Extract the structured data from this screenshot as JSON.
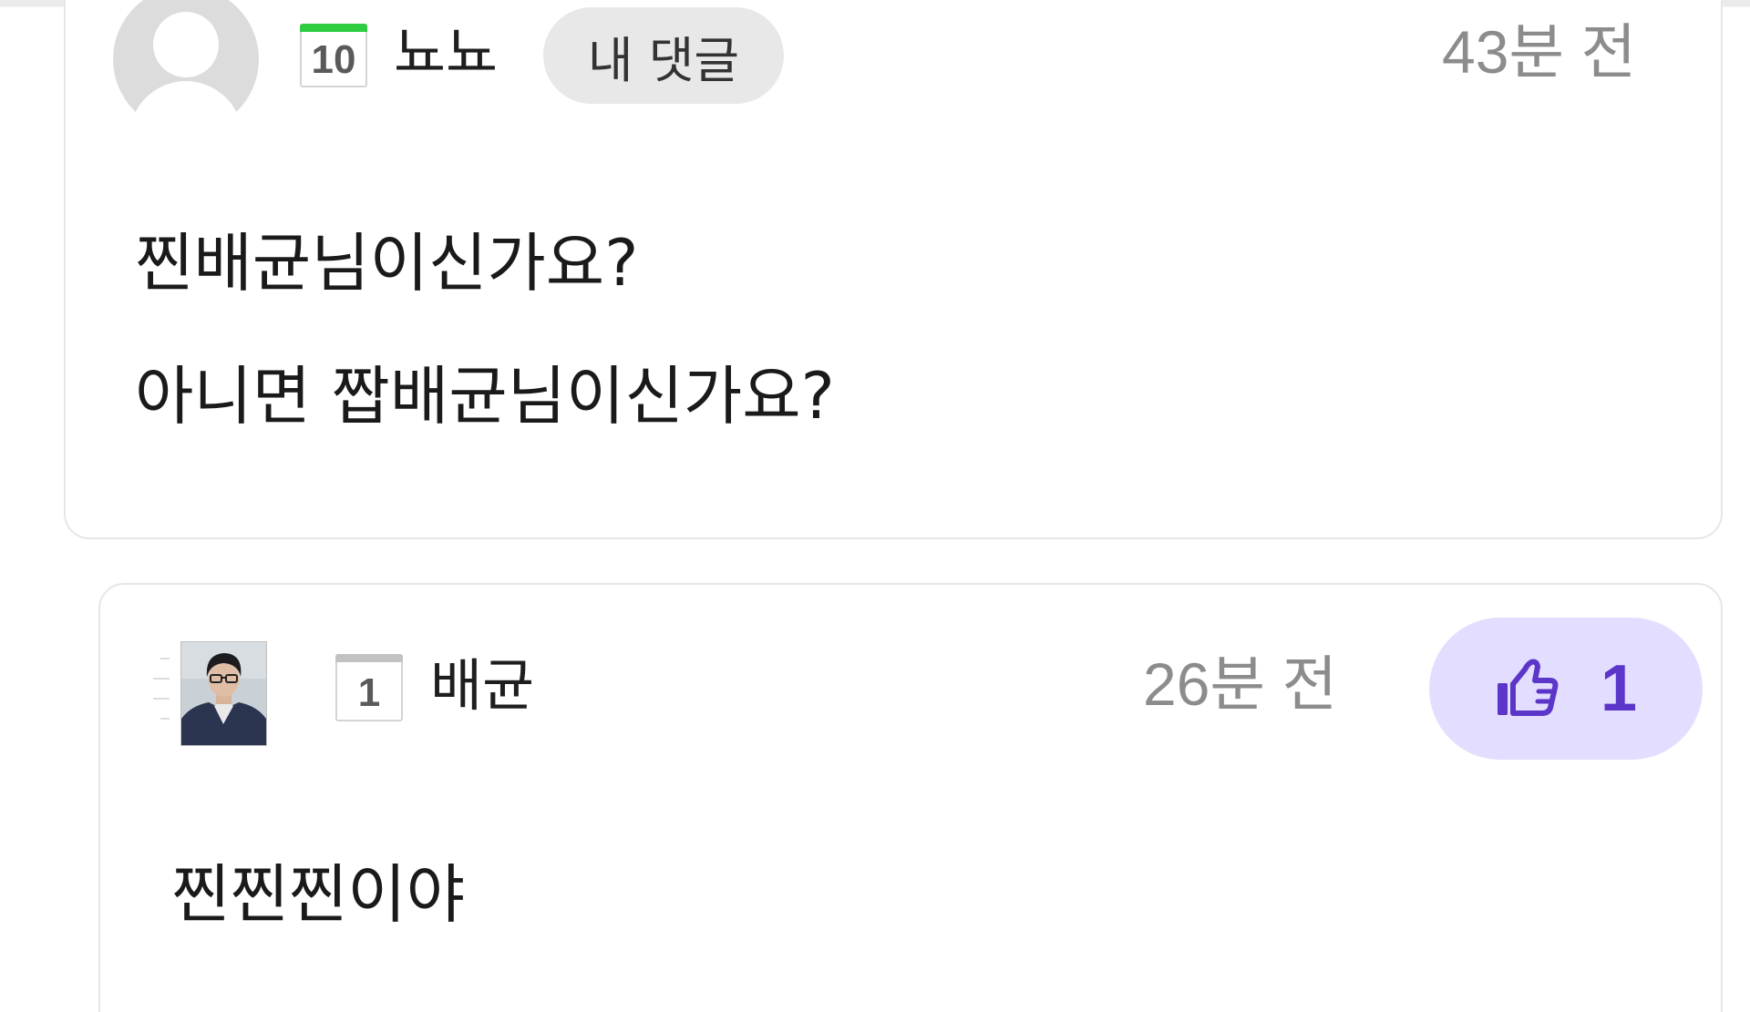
{
  "colors": {
    "accent": "#5b36c9",
    "like_bg": "#e3deff",
    "pill_bg": "#e8e8e8",
    "level_10_band": "#2ecc40",
    "level_1_band": "#c2c2c2",
    "timestamp": "#8c8c8c"
  },
  "comments": [
    {
      "level": "10",
      "nickname": "뇨뇨",
      "tag": "내 댓글",
      "time": "43분 전",
      "avatar_icon": "default-user-avatar-icon",
      "lines": [
        "찐배균님이신가요?",
        "아니면 짭배균님이신가요?"
      ]
    },
    {
      "level": "1",
      "nickname": "배균",
      "time": "26분 전",
      "avatar_icon": "profile-photo",
      "reply_icon": "reply-indent-icon",
      "like_icon": "thumbs-up-icon",
      "likes": "1",
      "lines": [
        "찐찐찐이야"
      ]
    }
  ]
}
